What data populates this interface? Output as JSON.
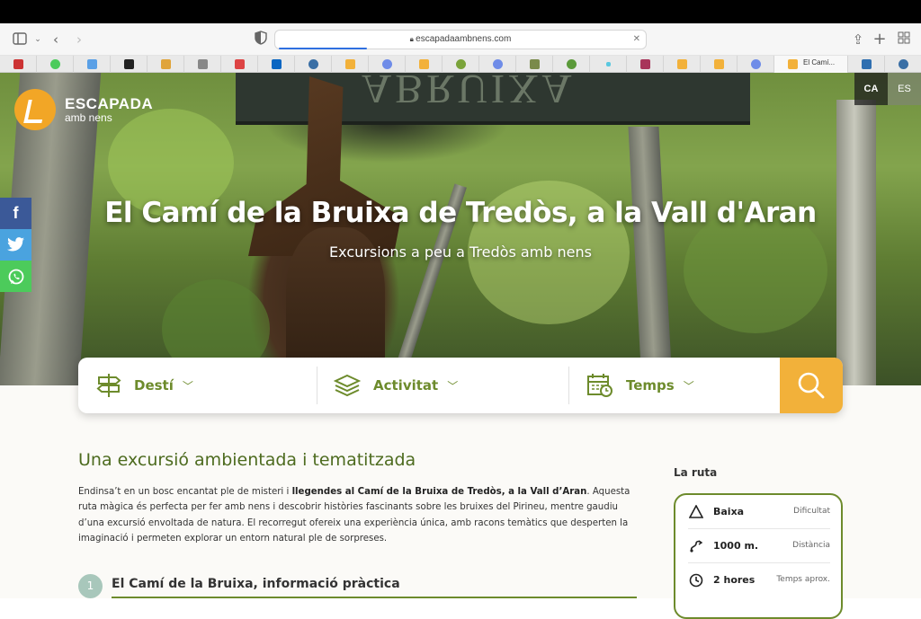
{
  "browser": {
    "url": "escapadaambnens.com",
    "active_tab_title": "El Camí..."
  },
  "site": {
    "logo_line1": "ESCAPADA",
    "logo_line2": "amb nens",
    "languages": [
      "CA",
      "ES"
    ]
  },
  "hero": {
    "title": "El Camí de la Bruixa de Tredòs, a la Vall d'Aran",
    "subtitle": "Excursions a peu a Tredòs amb nens"
  },
  "share": [
    "f",
    "twitter-icon",
    "whatsapp-icon"
  ],
  "search": {
    "fields": [
      "Destí",
      "Activitat",
      "Temps"
    ]
  },
  "article": {
    "section_title": "Una excursió ambientada i tematitzada",
    "para_intro": "Endinsa’t en un bosc encantat ple de misteri i ",
    "para_bold": "llegendes al Camí de la Bruixa de Tredòs, a la Vall d’Aran",
    "para_rest": ". Aquesta ruta màgica és perfecta per fer amb nens i descobrir històries fascinants sobre les bruixes del Pirineu, mentre gaudiu d’una excursió envoltada de natura. El recorregut ofereix una experiència única, amb racons temàtics que desperten la imaginació i permeten explorar un entorn natural ple de sorpreses.",
    "step_number": "1",
    "step_title": "El Camí de la Bruixa, informació pràctica"
  },
  "route": {
    "heading": "La ruta",
    "rows": [
      {
        "icon": "triangle-icon",
        "value": "Baixa",
        "label": "Dificultat"
      },
      {
        "icon": "route-icon",
        "value": "1000 m.",
        "label": "Distància"
      },
      {
        "icon": "clock-icon",
        "value": "2 hores",
        "label": "Temps aprox."
      }
    ]
  },
  "colors": {
    "accent_green": "#6d8b2c",
    "accent_orange": "#f2b13a",
    "facebook": "#3b5998",
    "twitter": "#4aa3df",
    "whatsapp": "#4ccb5b"
  }
}
